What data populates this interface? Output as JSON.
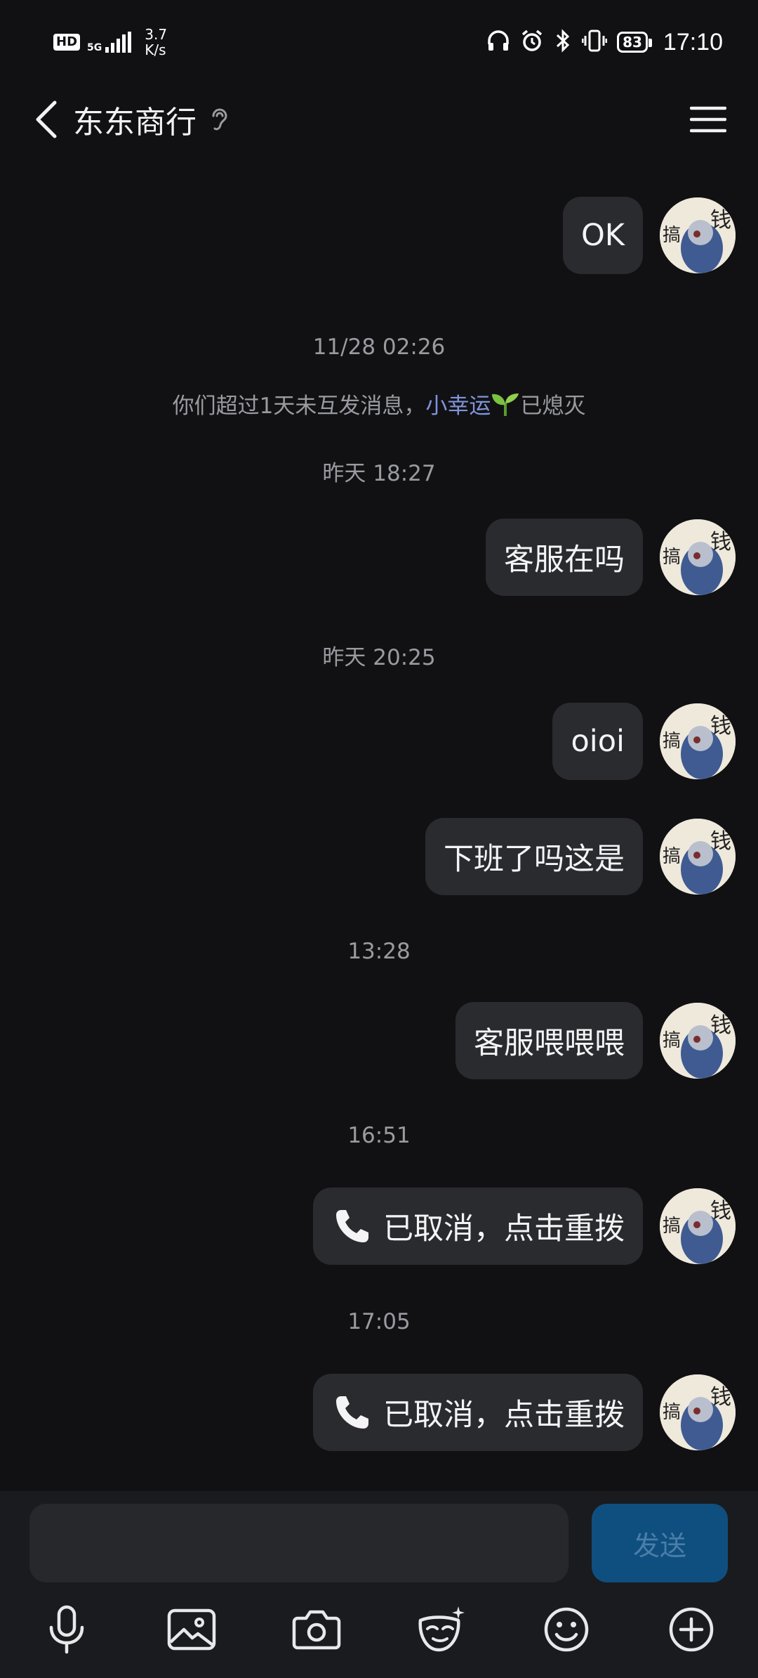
{
  "status_bar": {
    "hd": "HD",
    "network": "5G",
    "speed_value": "3.7",
    "speed_unit": "K/s",
    "battery": "83",
    "time": "17:10"
  },
  "header": {
    "title": "东东商行"
  },
  "messages": [
    {
      "type": "bubble",
      "text": "OK"
    },
    {
      "type": "timestamp",
      "text": "11/28 02:26"
    },
    {
      "type": "system",
      "prefix": "你们超过1天未互发消息，",
      "highlight": "小幸运",
      "suffix": "已熄灭"
    },
    {
      "type": "timestamp",
      "text": "昨天 18:27"
    },
    {
      "type": "bubble",
      "text": "客服在吗"
    },
    {
      "type": "timestamp",
      "text": "昨天 20:25"
    },
    {
      "type": "bubble",
      "text": "oioi"
    },
    {
      "type": "bubble",
      "text": "下班了吗这是"
    },
    {
      "type": "timestamp",
      "text": "13:28"
    },
    {
      "type": "bubble",
      "text": "客服喂喂喂"
    },
    {
      "type": "timestamp",
      "text": "16:51"
    },
    {
      "type": "call",
      "text": "已取消，点击重拨"
    },
    {
      "type": "timestamp",
      "text": "17:05"
    },
    {
      "type": "call",
      "text": "已取消，点击重拨"
    }
  ],
  "input": {
    "placeholder": "",
    "send_label": "发送"
  },
  "toolbar": {
    "icons": [
      "microphone-icon",
      "image-icon",
      "camera-icon",
      "mask-icon",
      "emoji-icon",
      "plus-icon"
    ]
  },
  "colors": {
    "background": "#111114",
    "bubble": "#2a2b2f",
    "send_button": "#0f4f80",
    "highlight": "#7f95d8"
  }
}
